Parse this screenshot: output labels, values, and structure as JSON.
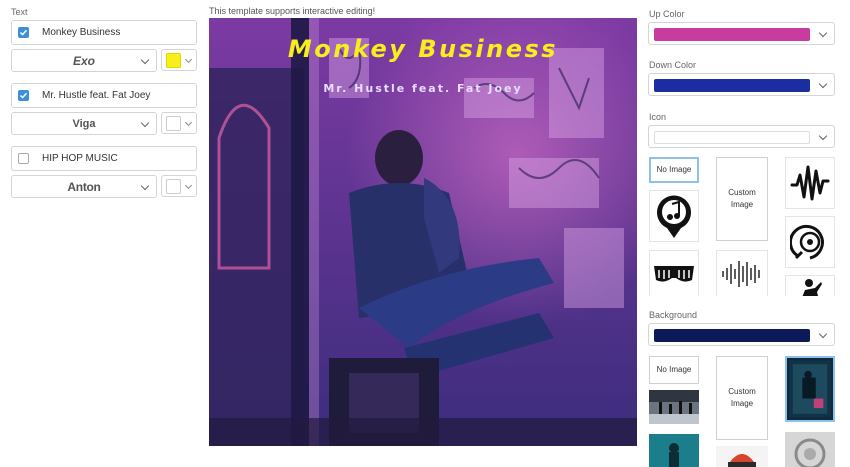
{
  "left_panel": {
    "section_label": "Text",
    "rows": [
      {
        "text": "Monkey Business",
        "checked": true,
        "font": "Exo",
        "color": "#f7ee1c"
      },
      {
        "text": "Mr. Hustle feat. Fat Joey",
        "checked": true,
        "font": "Viga",
        "color": "#ffffff"
      },
      {
        "text": "HIP HOP MUSIC",
        "checked": false,
        "font": "Anton",
        "color": "#ffffff"
      }
    ]
  },
  "center": {
    "notice": "This template supports interactive editing!",
    "cover_title": "Monkey Business",
    "cover_subtitle": "Mr. Hustle feat. Fat Joey"
  },
  "right_panel": {
    "up_color_label": "Up Color",
    "up_color": "#c93c9f",
    "down_color_label": "Down Color",
    "down_color": "#1b2ea1",
    "icon_label": "Icon",
    "icon_tiles": {
      "no_image": "No Image",
      "custom_image": "Custom Image",
      "icons": [
        "waveform-icon",
        "music-note-pin-icon",
        "vinyl-record-icon",
        "shutter-glasses-icon",
        "sound-bars-icon",
        "dancer-icon"
      ]
    },
    "background_label": "Background",
    "background_color": "#0c1a5a",
    "bg_tiles": {
      "no_image": "No Image",
      "custom_image": "Custom Image"
    }
  }
}
